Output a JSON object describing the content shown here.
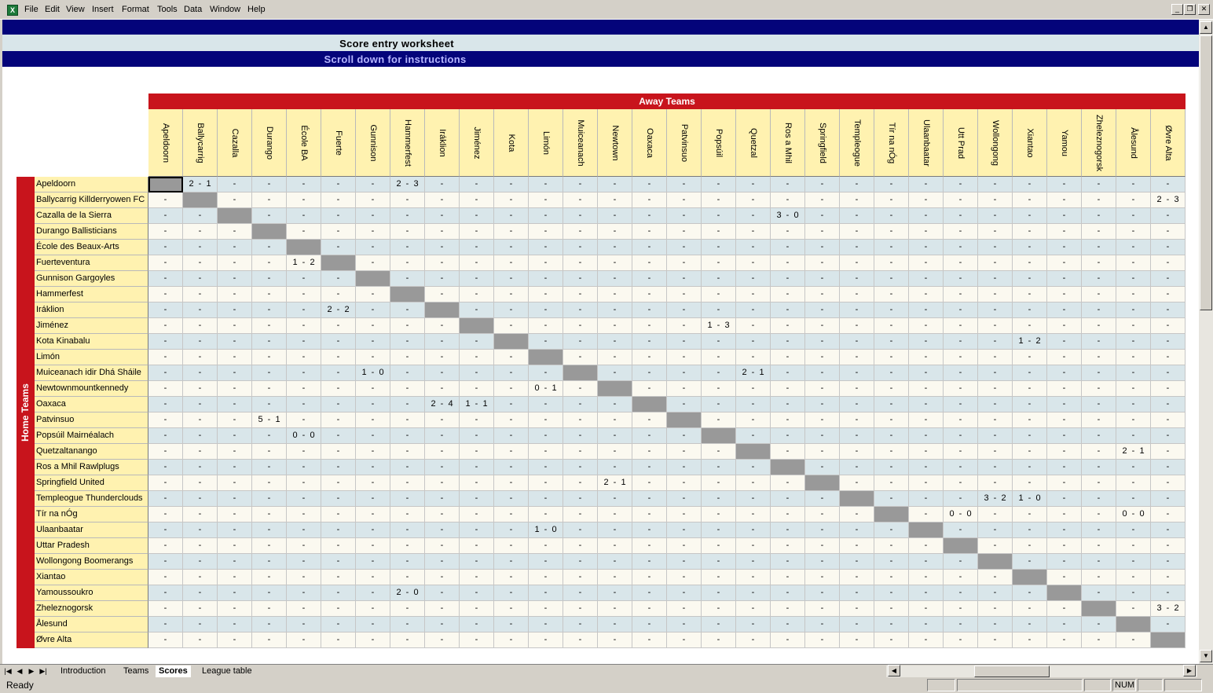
{
  "menu": [
    "File",
    "Edit",
    "View",
    "Insert",
    "Format",
    "Tools",
    "Data",
    "Window",
    "Help"
  ],
  "sheet": {
    "title": "Score entry worksheet",
    "instructions": "Scroll down for instructions",
    "away_label": "Away Teams",
    "home_label": "Home Teams"
  },
  "away_teams": [
    "Apeldoorn",
    "Ballycarrig",
    "Cazalla",
    "Durango",
    "École BA",
    "Fuerte",
    "Gunnison",
    "Hammerfest",
    "Iráklion",
    "Jiménez",
    "Kota",
    "Limón",
    "Muiceanach",
    "Newtown",
    "Oaxaca",
    "Patvinsuo",
    "Popsúil",
    "Quetzal",
    "Ros a Mhil",
    "Springfield",
    "Templeogue",
    "Tír na nÓg",
    "Ulaanbaatar",
    "Utt Prad",
    "Wollongong",
    "Xiantao",
    "Yamou",
    "Zheleznogorsk",
    "Ålesund",
    "Øvre Alta"
  ],
  "home_teams": [
    "Apeldoorn",
    "Ballycarrig Killderryowen FC",
    "Cazalla de la Sierra",
    "Durango Ballisticians",
    "École des Beaux-Arts",
    "Fuerteventura",
    "Gunnison Gargoyles",
    "Hammerfest",
    "Iráklion",
    "Jiménez",
    "Kota Kinabalu",
    "Limón",
    "Muiceanach idir Dhá Sháile",
    "Newtownmountkennedy",
    "Oaxaca",
    "Patvinsuo",
    "Popsúil Mairnéalach",
    "Quetzaltanango",
    "Ros a Mhil Rawlplugs",
    "Springfield United",
    "Templeogue Thunderclouds",
    "Tír na nÓg",
    "Ulaanbaatar",
    "Uttar Pradesh",
    "Wollongong Boomerangs",
    "Xiantao",
    "Yamoussoukro",
    "Zheleznogorsk",
    "Ålesund",
    "Øvre Alta"
  ],
  "empty_mark": "-",
  "scores": [
    {
      "home": 0,
      "away": 1,
      "score": "2  -  1"
    },
    {
      "home": 0,
      "away": 7,
      "score": "2  -  3"
    },
    {
      "home": 1,
      "away": 29,
      "score": "2  -  3"
    },
    {
      "home": 2,
      "away": 18,
      "score": "3  -  0"
    },
    {
      "home": 5,
      "away": 4,
      "score": "1  -  2"
    },
    {
      "home": 8,
      "away": 5,
      "score": "2  -  2"
    },
    {
      "home": 9,
      "away": 16,
      "score": "1  -  3"
    },
    {
      "home": 10,
      "away": 25,
      "score": "1  -  2"
    },
    {
      "home": 12,
      "away": 6,
      "score": "1  -  0"
    },
    {
      "home": 12,
      "away": 17,
      "score": "2  -  1"
    },
    {
      "home": 13,
      "away": 11,
      "score": "0  -  1"
    },
    {
      "home": 14,
      "away": 8,
      "score": "2  -  4"
    },
    {
      "home": 14,
      "away": 9,
      "score": "1  -  1"
    },
    {
      "home": 15,
      "away": 3,
      "score": "5  -  1"
    },
    {
      "home": 16,
      "away": 4,
      "score": "0  -  0"
    },
    {
      "home": 17,
      "away": 28,
      "score": "2  -  1"
    },
    {
      "home": 19,
      "away": 13,
      "score": "2  -  1"
    },
    {
      "home": 20,
      "away": 24,
      "score": "3  -  2"
    },
    {
      "home": 20,
      "away": 25,
      "score": "1  -  0"
    },
    {
      "home": 21,
      "away": 23,
      "score": "0  -  0"
    },
    {
      "home": 21,
      "away": 28,
      "score": "0  -  0"
    },
    {
      "home": 22,
      "away": 11,
      "score": "1  -  0"
    },
    {
      "home": 26,
      "away": 7,
      "score": "2  -  0"
    },
    {
      "home": 27,
      "away": 29,
      "score": "3  -  2"
    }
  ],
  "tabs": [
    {
      "label": "Introduction",
      "active": false
    },
    {
      "label": "Teams",
      "active": false
    },
    {
      "label": "Scores",
      "active": true
    },
    {
      "label": "League table",
      "active": false
    }
  ],
  "status": {
    "text": "Ready",
    "num": "NUM"
  },
  "colors": {
    "navy": "#04047a",
    "red": "#c8141c",
    "header_yellow": "#fff2b0",
    "row_blue": "#d9e6ea",
    "row_cream": "#fbf9f0",
    "diagonal_gray": "#999999"
  }
}
